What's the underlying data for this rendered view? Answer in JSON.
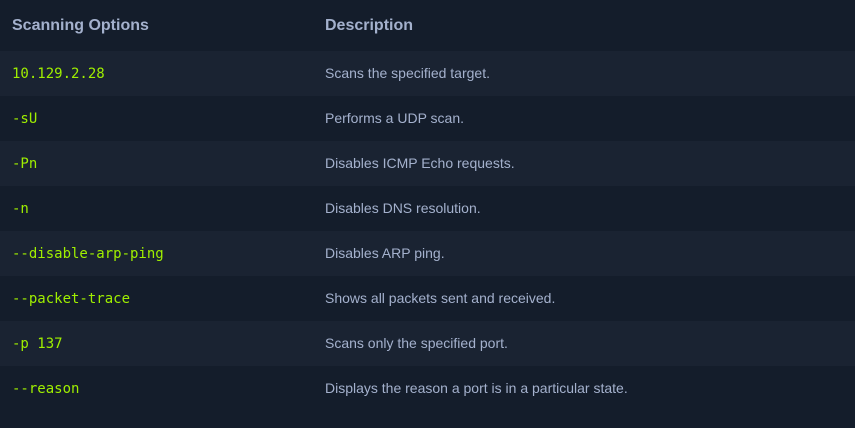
{
  "table": {
    "headers": [
      "Scanning Options",
      "Description"
    ],
    "rows": [
      {
        "option": "10.129.2.28",
        "description": "Scans the specified target."
      },
      {
        "option": "-sU",
        "description": "Performs a UDP scan."
      },
      {
        "option": "-Pn",
        "description": "Disables ICMP Echo requests."
      },
      {
        "option": "-n",
        "description": "Disables DNS resolution."
      },
      {
        "option": "--disable-arp-ping",
        "description": "Disables ARP ping."
      },
      {
        "option": "--packet-trace",
        "description": "Shows all packets sent and received."
      },
      {
        "option": "-p 137",
        "description": "Scans only the specified port."
      },
      {
        "option": "--reason",
        "description": "Displays the reason a port is in a particular state."
      }
    ]
  },
  "colors": {
    "background": "#141d2b",
    "row_alt": "#1a2332",
    "option_text": "#9fef00",
    "description_text": "#a4b1cd",
    "header_text": "#a4b1cd"
  }
}
